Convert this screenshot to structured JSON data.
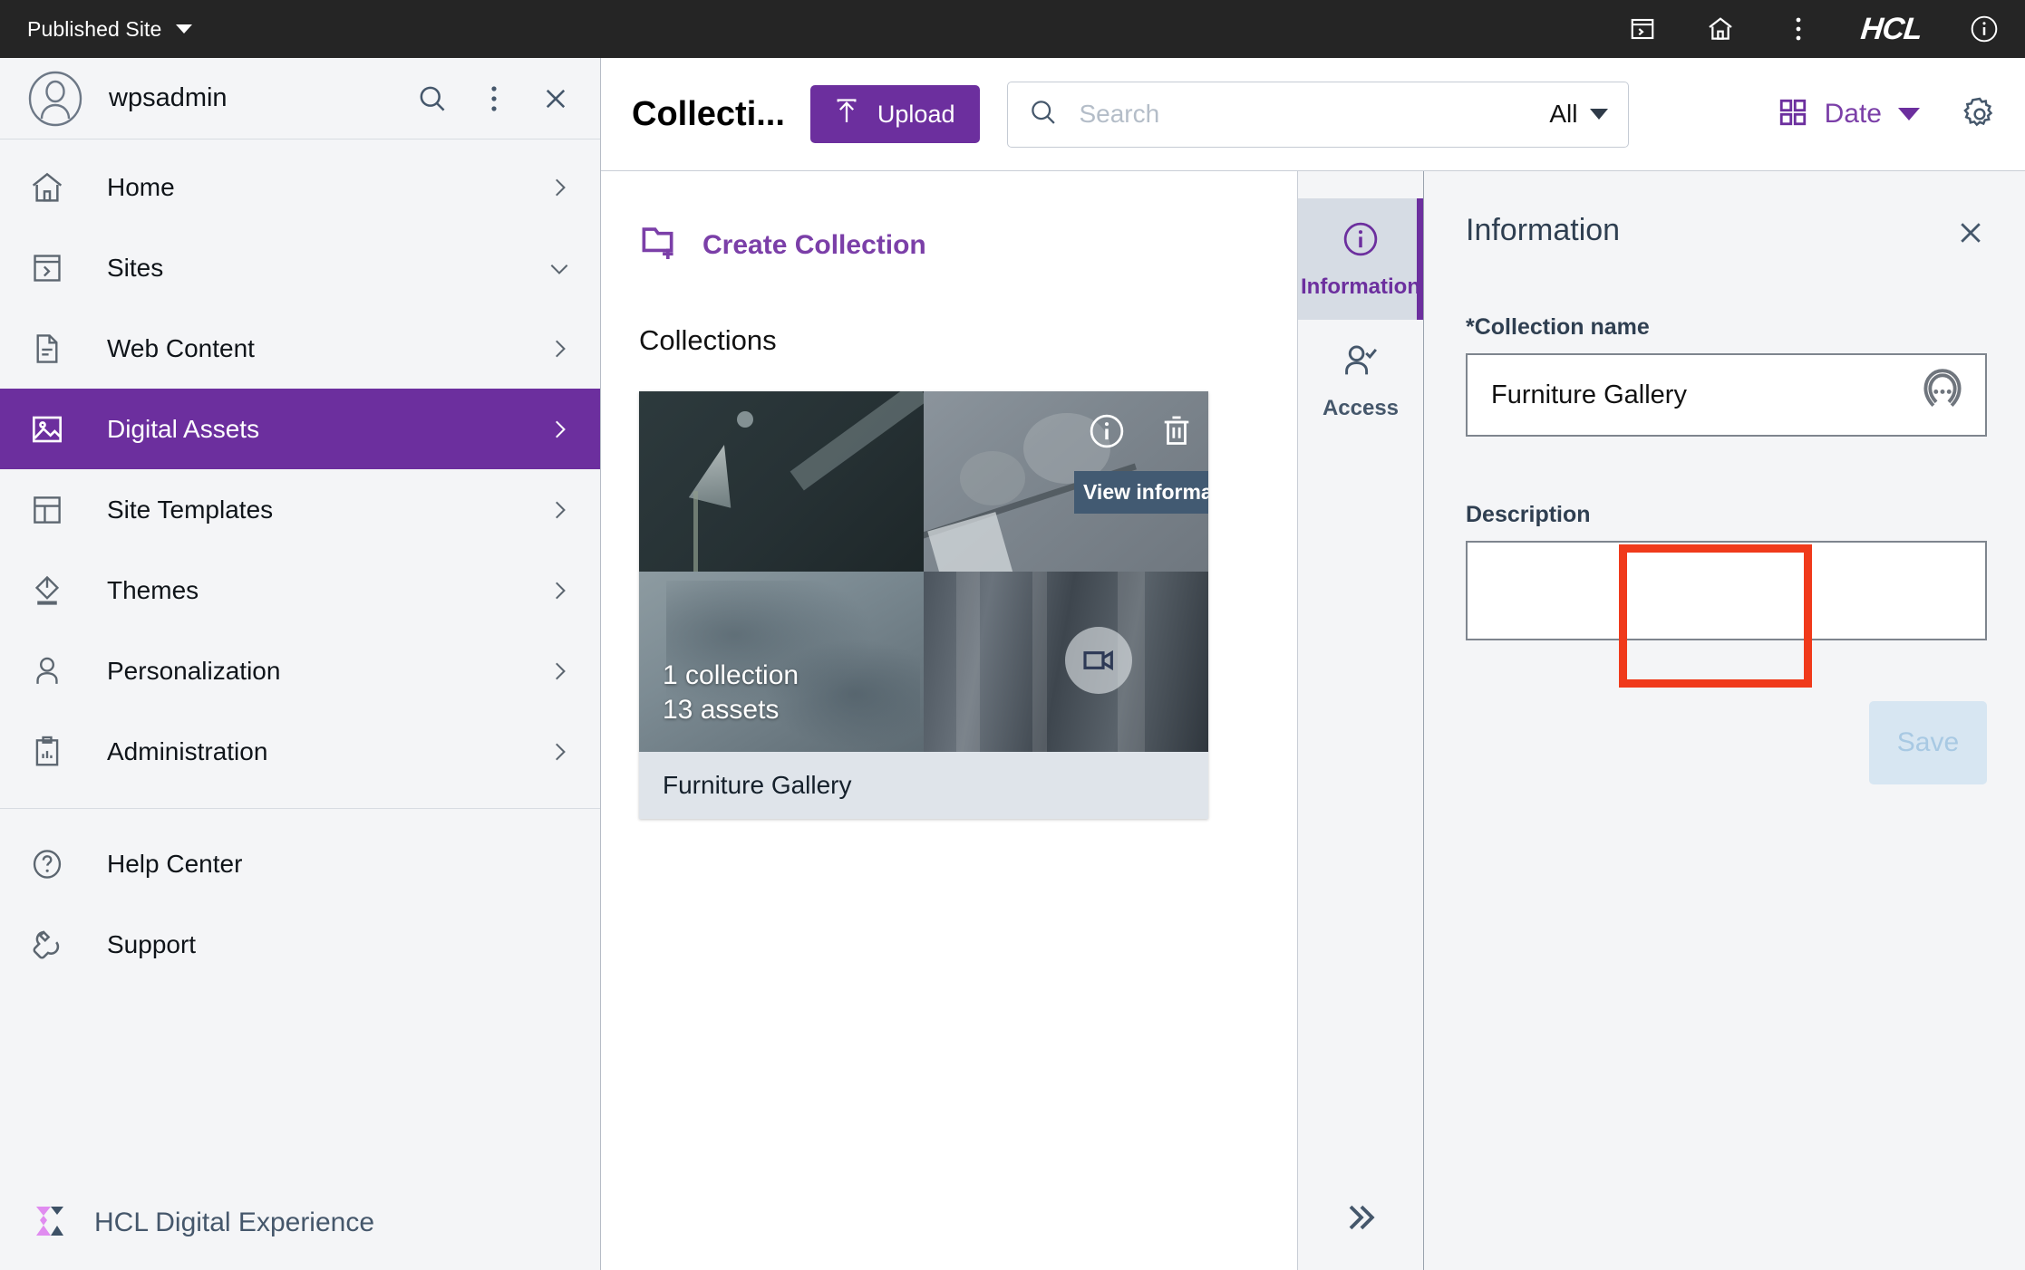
{
  "topbar": {
    "site_selector_label": "Published Site",
    "icons": [
      "sites-icon",
      "home-icon",
      "more-vertical-icon",
      "info-circle-icon"
    ],
    "brand": "HCL"
  },
  "sidebar": {
    "user": {
      "name": "wpsadmin"
    },
    "user_actions": [
      "search-icon",
      "more-vertical-icon",
      "close-icon"
    ],
    "items": [
      {
        "label": "Home",
        "icon": "home-icon",
        "chevron": "right",
        "active": false
      },
      {
        "label": "Sites",
        "icon": "sites-icon",
        "chevron": "down",
        "active": false
      },
      {
        "label": "Web Content",
        "icon": "document-icon",
        "chevron": "right",
        "active": false
      },
      {
        "label": "Digital Assets",
        "icon": "image-icon",
        "chevron": "right",
        "active": true
      },
      {
        "label": "Site Templates",
        "icon": "layout-icon",
        "chevron": "right",
        "active": false
      },
      {
        "label": "Themes",
        "icon": "paint-bucket-icon",
        "chevron": "right",
        "active": false
      },
      {
        "label": "Personalization",
        "icon": "person-icon",
        "chevron": "right",
        "active": false
      },
      {
        "label": "Administration",
        "icon": "clipboard-chart-icon",
        "chevron": "right",
        "active": false
      }
    ],
    "secondary_items": [
      {
        "label": "Help Center",
        "icon": "question-circle-icon"
      },
      {
        "label": "Support",
        "icon": "wrench-icon"
      }
    ],
    "footer": {
      "product_name": "HCL Digital Experience"
    }
  },
  "toolbar": {
    "page_title": "Collecti...",
    "upload_label": "Upload",
    "search": {
      "placeholder": "Search",
      "value": ""
    },
    "filter": {
      "selected": "All"
    },
    "sort": {
      "label": "Date",
      "view_icon": "grid-view-icon"
    },
    "settings_icon": "gear-icon"
  },
  "content": {
    "create_collection_label": "Create Collection",
    "collections_heading": "Collections",
    "card": {
      "collection_count": "1 collection",
      "asset_count": "13 assets",
      "name": "Furniture Gallery",
      "actions": {
        "info_icon": "info-circle-icon",
        "delete_icon": "trash-icon",
        "tooltip": "View information"
      },
      "video_badge_icon": "video-camera-icon"
    },
    "highlight_color": "#f03a1b"
  },
  "tabrail": {
    "tabs": [
      {
        "label": "Information",
        "icon": "info-circle-icon",
        "active": true
      },
      {
        "label": "Access",
        "icon": "person-check-icon",
        "active": false
      }
    ],
    "expand_icon": "chevron-double-right-icon"
  },
  "panel": {
    "title": "Information",
    "close_icon": "close-icon",
    "fields": [
      {
        "label": "*Collection name",
        "value": "Furniture Gallery",
        "trailing_icon": "localization-icon"
      },
      {
        "label": "Description",
        "value": ""
      }
    ],
    "save_label": "Save"
  },
  "colors": {
    "accent_purple": "#6c2f9e",
    "link_purple": "#7b3fa8",
    "topbar_dark": "#252525",
    "sidebar_bg": "#f4f5f7",
    "highlight_red": "#f03a1b",
    "slate": "#45576b"
  }
}
